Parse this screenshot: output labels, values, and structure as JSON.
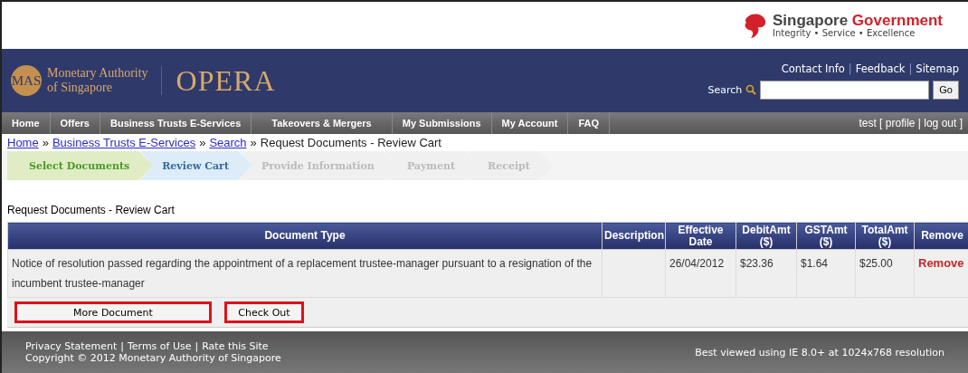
{
  "gov_banner": {
    "name_part1": "Singapore",
    "name_part2": "Government",
    "tagline": "Integrity • Service • Excellence"
  },
  "header": {
    "logo_mark": "MAS",
    "logo_text_line1": "Monetary Authority",
    "logo_text_line2": "of Singapore",
    "app_name": "OPERA",
    "top_links": [
      "Contact Info",
      "Feedback",
      "Sitemap"
    ],
    "link_separator": "|",
    "search_label": "Search",
    "go_button": "Go"
  },
  "nav": {
    "items": [
      "Home",
      "Offers",
      "Business Trusts E-Services",
      "Takeovers & Mergers",
      "My Submissions",
      "My Account",
      "FAQ"
    ],
    "user": "test",
    "user_links": [
      "profile",
      "log out"
    ],
    "bracket_open": "[",
    "bracket_close": "]",
    "link_separator": "|"
  },
  "breadcrumb": {
    "links": [
      "Home",
      "Business Trusts E-Services",
      "Search"
    ],
    "current": "Request Documents - Review Cart",
    "separator": "»"
  },
  "steps": [
    {
      "label": "Select Documents",
      "completed": true,
      "selected": false
    },
    {
      "label": "Review Cart",
      "completed": false,
      "selected": true
    },
    {
      "label": "Provide Information",
      "completed": false,
      "selected": false
    },
    {
      "label": "Payment",
      "completed": false,
      "selected": false
    },
    {
      "label": "Receipt",
      "completed": false,
      "selected": false
    }
  ],
  "page_title": "Request Documents - Review Cart",
  "table": {
    "columns": [
      "Document Type",
      "Description",
      "Effective Date",
      "DebitAmt ($)",
      "GSTAmt ($)",
      "TotalAmt ($)",
      "Remove"
    ],
    "rows": [
      {
        "document_type": "Notice of resolution passed regarding the appointment of a replacement trustee-manager pursuant to a resignation of the incumbent trustee-manager",
        "effective_date": "26/04/2012",
        "debit_amt": "$23.36",
        "gst_amt": "$1.64",
        "total_amt": "$25.00",
        "remove": "Remove"
      }
    ]
  },
  "buttons": [
    "More Document",
    "Check Out"
  ],
  "footer": {
    "links": [
      "Privacy Statement",
      "Terms of Use",
      "Rate this Site"
    ],
    "link_separator": "|",
    "copyright": "Copyright © 2012 Monetary Authority of Singapore",
    "note": "Best viewed using IE 8.0+ at 1024x768 resolution"
  }
}
